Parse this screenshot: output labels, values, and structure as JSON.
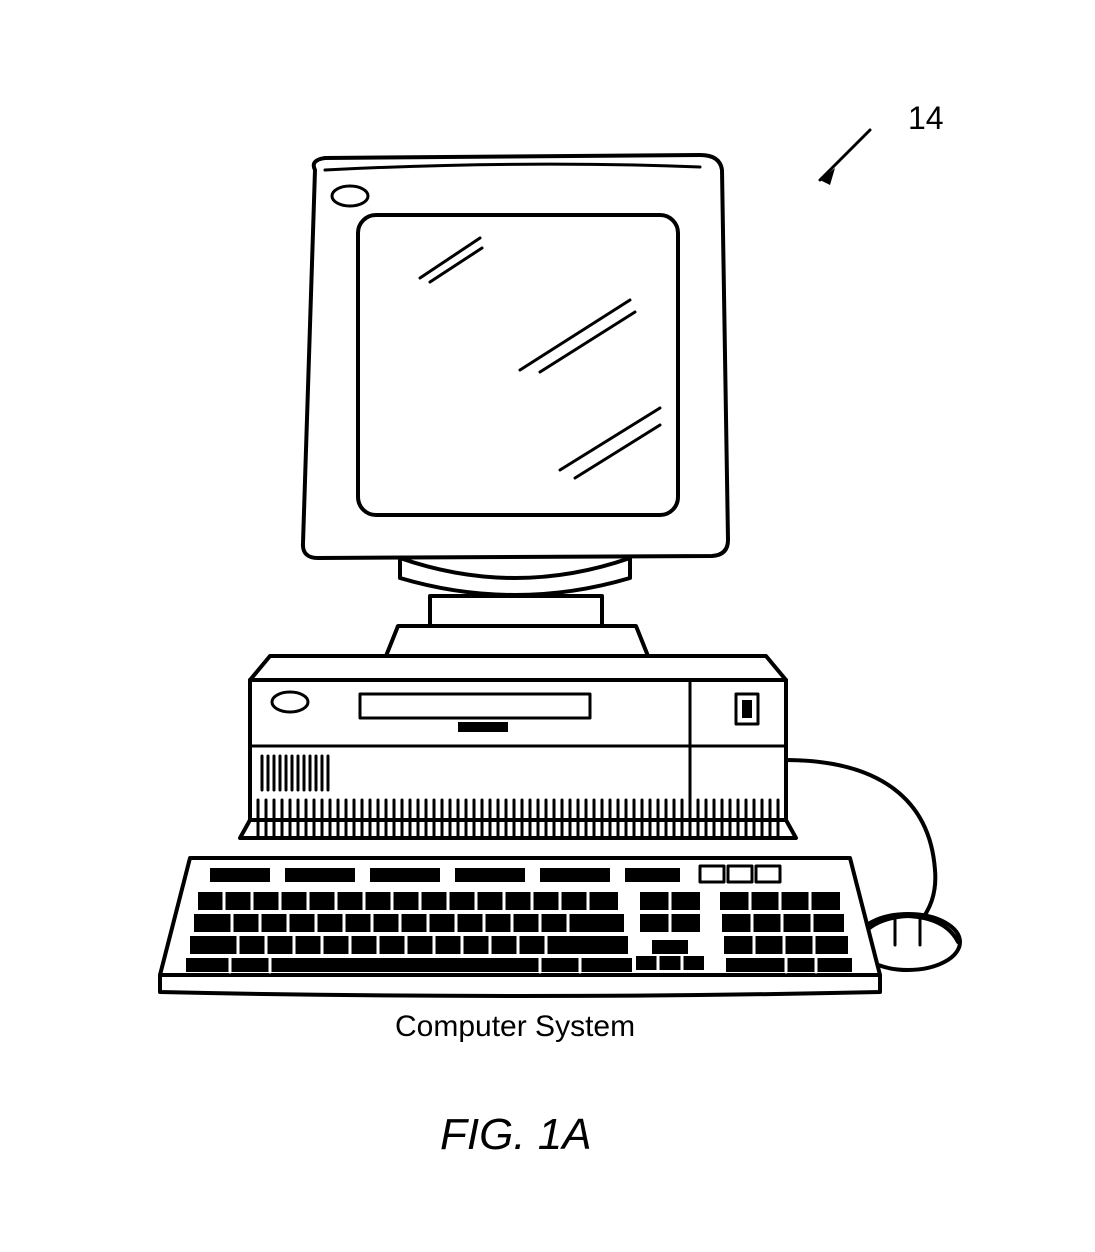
{
  "reference": {
    "number": "14"
  },
  "component": {
    "caption": "Computer System"
  },
  "figure": {
    "label": "FIG. 1A"
  },
  "colors": {
    "stroke": "#000000",
    "fill": "#ffffff"
  }
}
